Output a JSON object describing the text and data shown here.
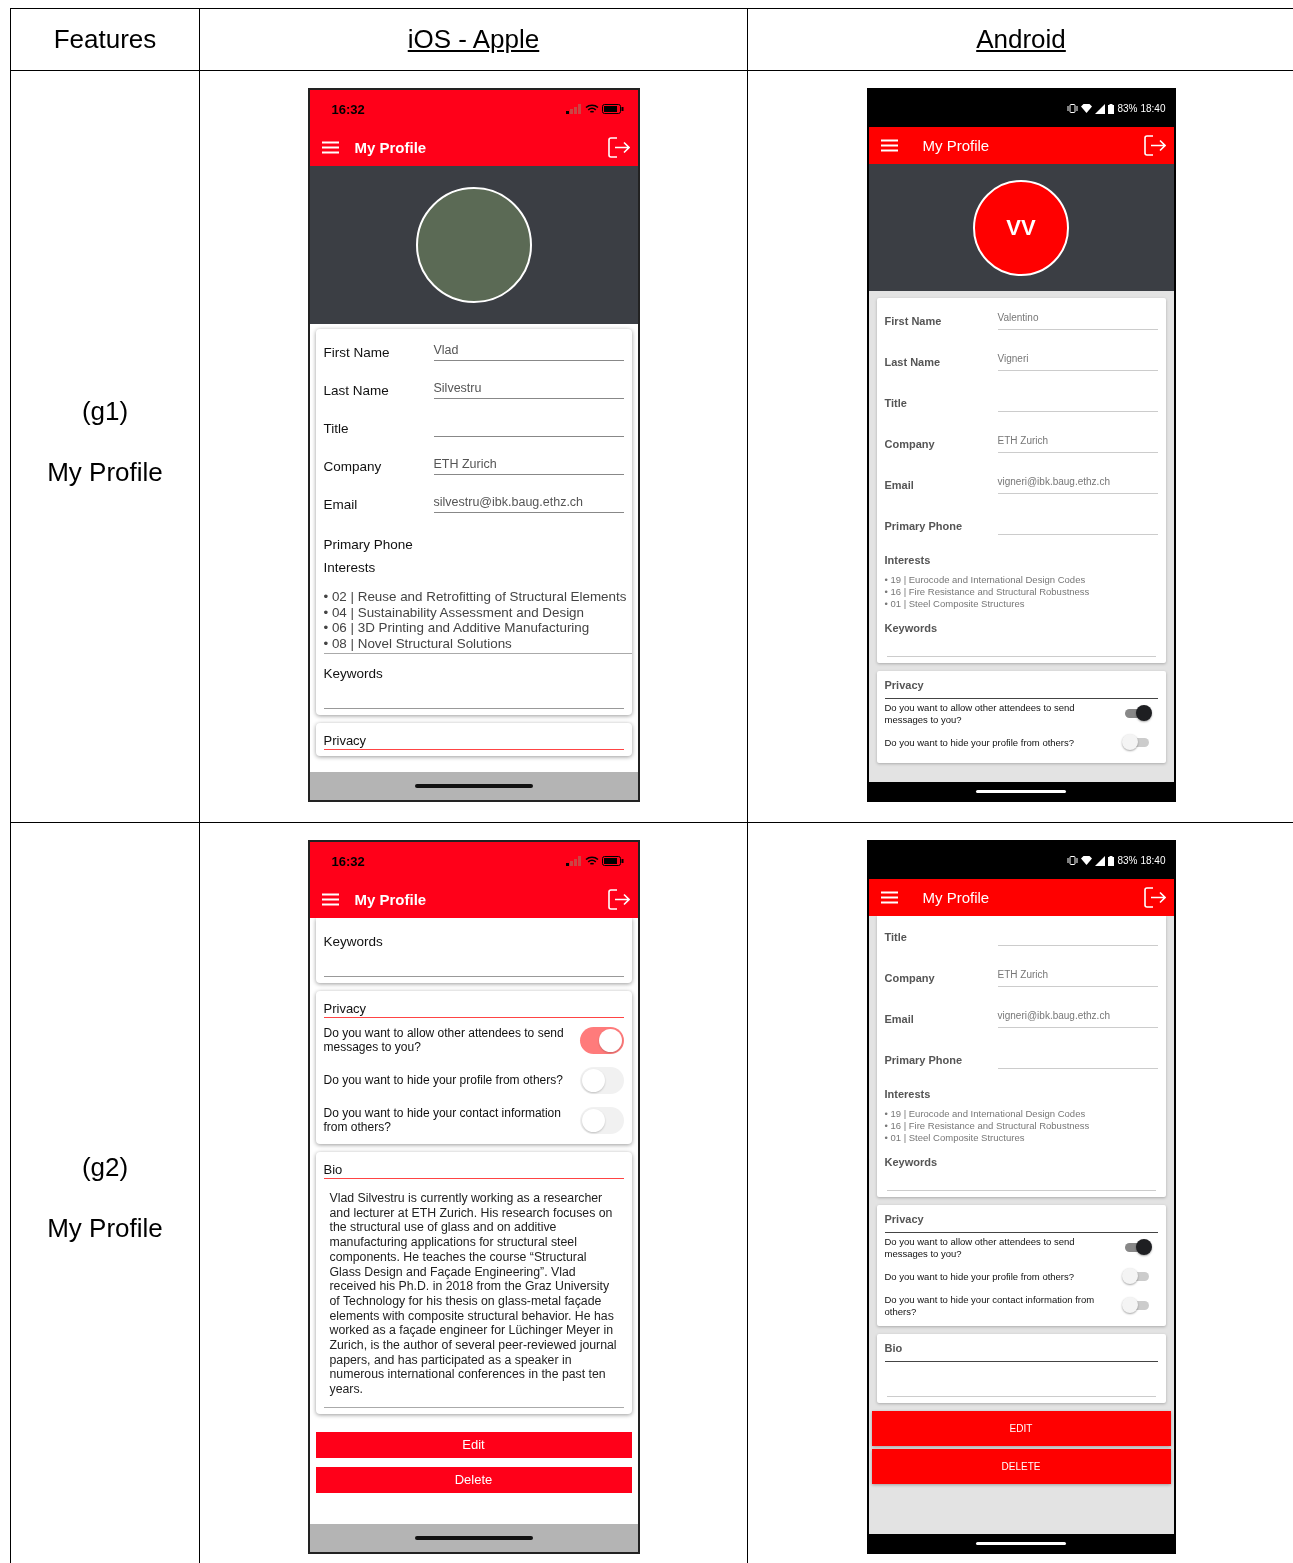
{
  "header": [
    {
      "text": "Features",
      "underlined": false
    },
    {
      "text": "iOS - Apple",
      "underlined": true
    },
    {
      "text": "Android",
      "underlined": true
    }
  ],
  "rows": [
    {
      "code": "(g1)",
      "label": "My Profile",
      "ios": {
        "kind": "ios",
        "status": {
          "time": "16:32"
        },
        "title": "My Profile",
        "avatar": {
          "kind": "photo"
        },
        "blocks": [
          {
            "kind": "card",
            "scrolled": false,
            "items": [
              {
                "kind": "field",
                "label": "First Name",
                "value": "Vlad"
              },
              {
                "kind": "field",
                "label": "Last Name",
                "value": "Silvestru"
              },
              {
                "kind": "field",
                "label": "Title"
              },
              {
                "kind": "field",
                "label": "Company",
                "value": "ETH Zurich"
              },
              {
                "kind": "field",
                "label": "Email",
                "value": "silvestru@ibk.baug.ethz.ch"
              },
              {
                "kind": "label",
                "label": "Primary Phone"
              },
              {
                "kind": "interests",
                "label": "Interests",
                "items": [
                  "•  02 | Reuse and Retrofitting of Structural Elements",
                  "•  04 | Sustainability Assessment and Design",
                  "•  06 | 3D Printing and Additive Manufacturing",
                  "•  08 | Novel Structural Solutions"
                ]
              },
              {
                "kind": "area",
                "label": "Keywords"
              }
            ]
          },
          {
            "kind": "card",
            "scrolled": false,
            "items": [
              {
                "kind": "section",
                "label": "Privacy"
              }
            ]
          }
        ]
      },
      "android": {
        "kind": "android",
        "status": {
          "battery": "83%",
          "time": "18:40"
        },
        "title": "My Profile",
        "avatar": {
          "kind": "initials",
          "text": "VV"
        },
        "blocks": [
          {
            "kind": "card",
            "scrolled": false,
            "items": [
              {
                "kind": "field",
                "label": "First Name",
                "value": "Valentino"
              },
              {
                "kind": "field",
                "label": "Last Name",
                "value": "Vigneri"
              },
              {
                "kind": "field",
                "label": "Title"
              },
              {
                "kind": "field",
                "label": "Company",
                "value": "ETH Zurich"
              },
              {
                "kind": "field",
                "label": "Email",
                "value": "vigneri@ibk.baug.ethz.ch"
              },
              {
                "kind": "field",
                "label": "Primary Phone"
              },
              {
                "kind": "interests",
                "label": "Interests",
                "items": [
                  "• 19 | Eurocode and International Design Codes",
                  "• 16 | Fire Resistance and Structural Robustness",
                  "• 01 | Steel Composite Structures"
                ]
              },
              {
                "kind": "area",
                "label": "Keywords"
              }
            ]
          },
          {
            "kind": "card",
            "scrolled": false,
            "items": [
              {
                "kind": "section",
                "label": "Privacy"
              },
              {
                "kind": "toggle",
                "text": "Do you want to allow other attendees to send messages to you?",
                "on": true
              },
              {
                "kind": "toggle",
                "text": "Do you want to hide your profile from others?",
                "on": false
              }
            ]
          }
        ]
      }
    },
    {
      "code": "(g2)",
      "label": "My Profile",
      "ios": {
        "kind": "ios",
        "status": {
          "time": "16:32"
        },
        "title": "My Profile",
        "blocks": [
          {
            "kind": "card",
            "scrolled": true,
            "items": [
              {
                "kind": "area",
                "label": "Keywords"
              }
            ]
          },
          {
            "kind": "card",
            "scrolled": false,
            "items": [
              {
                "kind": "section",
                "label": "Privacy"
              },
              {
                "kind": "toggle",
                "text": "Do you want to allow other attendees to send messages to you?",
                "on": true
              },
              {
                "kind": "toggle",
                "text": "Do you want to hide your profile from others?",
                "on": false
              },
              {
                "kind": "toggle",
                "text": "Do you want to hide your contact information from others?",
                "on": false
              }
            ]
          },
          {
            "kind": "card",
            "scrolled": false,
            "items": [
              {
                "kind": "section",
                "label": "Bio"
              },
              {
                "kind": "bio",
                "text": "Vlad Silvestru is currently working as a researcher and lecturer at ETH Zurich. His research focuses on the structural use of glass and on additive manufacturing applications for structural steel components. He teaches the course “Structural Glass Design and Façade Engineering”. Vlad received his Ph.D. in 2018 from the Graz University of Technology for his thesis on glass-metal façade elements with composite structural behavior. He has worked as a façade engineer for Lüchinger Meyer in Zurich, is the author of several peer-reviewed journal papers, and has participated as a speaker in numerous international conferences in the past ten years."
              }
            ]
          },
          {
            "kind": "button",
            "label": "Edit"
          },
          {
            "kind": "button",
            "label": "Delete"
          }
        ]
      },
      "android": {
        "kind": "android",
        "status": {
          "battery": "83%",
          "time": "18:40"
        },
        "title": "My Profile",
        "blocks": [
          {
            "kind": "card",
            "scrolled": true,
            "items": [
              {
                "kind": "field",
                "label": "Title"
              },
              {
                "kind": "field",
                "label": "Company",
                "value": "ETH Zurich"
              },
              {
                "kind": "field",
                "label": "Email",
                "value": "vigneri@ibk.baug.ethz.ch"
              },
              {
                "kind": "field",
                "label": "Primary Phone"
              },
              {
                "kind": "interests",
                "label": "Interests",
                "items": [
                  "• 19 | Eurocode and International Design Codes",
                  "• 16 | Fire Resistance and Structural Robustness",
                  "• 01 | Steel Composite Structures"
                ]
              },
              {
                "kind": "area",
                "label": "Keywords"
              }
            ]
          },
          {
            "kind": "card",
            "scrolled": false,
            "items": [
              {
                "kind": "section",
                "label": "Privacy"
              },
              {
                "kind": "toggle",
                "text": "Do you want to allow other attendees to send messages to you?",
                "on": true
              },
              {
                "kind": "toggle",
                "text": "Do you want to hide your profile from others?",
                "on": false
              },
              {
                "kind": "toggle",
                "text": "Do you want to hide your contact information from others?",
                "on": false
              }
            ]
          },
          {
            "kind": "card",
            "scrolled": false,
            "items": [
              {
                "kind": "section",
                "label": "Bio"
              },
              {
                "kind": "line"
              }
            ]
          },
          {
            "kind": "button",
            "label": "EDIT"
          },
          {
            "kind": "button",
            "label": "DELETE"
          }
        ]
      }
    }
  ]
}
